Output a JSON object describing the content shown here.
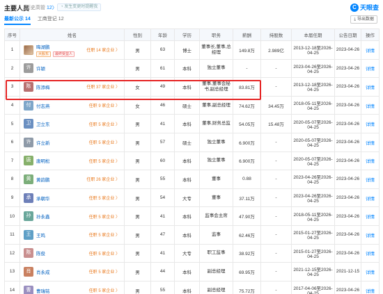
{
  "header": {
    "title": "主要人员",
    "history_label": "历史高管",
    "history_count": "12",
    "follow_label": "发生变更时提醒我",
    "logo_text": "天眼查"
  },
  "tabs": [
    {
      "label": "最新公示",
      "count": "14"
    },
    {
      "label": "工商登记",
      "count": "12"
    }
  ],
  "export_label": "导出数据",
  "columns": [
    "序号",
    "姓名",
    "性别",
    "年龄",
    "学历",
    "职务",
    "薪酬",
    "持股数",
    "本届任期",
    "公告日期",
    "操作"
  ],
  "rows": [
    {
      "no": "1",
      "avatar": "",
      "avatar_color": "#a07050",
      "name": "晦湖鹏",
      "tags": [
        "大股东",
        "最终受益人"
      ],
      "posts": "任职 14 家企业 〉",
      "gender": "男",
      "age": "63",
      "edu": "博士",
      "position": "董事长,董事,总经理",
      "salary": "149.8万",
      "shares": "2.989亿",
      "term": "2013-12-18至2026-04-25",
      "date": "2023-04-26",
      "action": "详情"
    },
    {
      "no": "2",
      "avatar": "许",
      "avatar_color": "#9c9c9c",
      "name": "许颖",
      "tags": [],
      "posts": "",
      "gender": "男",
      "age": "61",
      "edu": "本科",
      "position": "独立董事",
      "salary": "-",
      "shares": "-",
      "term": "2023-04-26至2026-04-25",
      "date": "2023-04-26",
      "action": "详情"
    },
    {
      "no": "3",
      "avatar": "陈",
      "avatar_color": "#b87070",
      "name": "陈添梅",
      "tags": [],
      "posts": "任职 37 家企业 〉",
      "gender": "女",
      "age": "49",
      "edu": "本科",
      "position": "董事,董事会秘书,副总经理",
      "salary": "83.81万",
      "shares": "-",
      "term": "2013-12-18至2026-04-25",
      "date": "2023-04-26",
      "action": "详情"
    },
    {
      "no": "4",
      "avatar": "付",
      "avatar_color": "#7ea6c9",
      "name": "付志燕",
      "tags": [],
      "posts": "任职 9 家企业 〉",
      "gender": "女",
      "age": "46",
      "edu": "硕士",
      "position": "董事,副总经理",
      "salary": "74.62万",
      "shares": "34.45万",
      "term": "2018-05-11至2026-04-25",
      "date": "2023-04-26",
      "action": "详情"
    },
    {
      "no": "5",
      "avatar": "卫",
      "avatar_color": "#6a8fc1",
      "name": "卫立东",
      "tags": [],
      "posts": "任职 5 家企业 〉",
      "gender": "男",
      "age": "41",
      "edu": "本科",
      "position": "董事,财务总监",
      "salary": "54.05万",
      "shares": "15.48万",
      "term": "2020-05-07至2026-04-25",
      "date": "2023-04-26",
      "action": "详情"
    },
    {
      "no": "6",
      "avatar": "许",
      "avatar_color": "#8e9aa8",
      "name": "许立新",
      "tags": [],
      "posts": "任职 5 家企业 〉",
      "gender": "男",
      "age": "57",
      "edu": "硕士",
      "position": "独立董事",
      "salary": "6.900万",
      "shares": "-",
      "term": "2020-05-07至2026-04-25",
      "date": "2023-04-26",
      "action": "详情"
    },
    {
      "no": "7",
      "avatar": "唐",
      "avatar_color": "#86b06a",
      "name": "唐明松",
      "tags": [],
      "posts": "任职 5 家企业 〉",
      "gender": "男",
      "age": "60",
      "edu": "本科",
      "position": "独立董事",
      "salary": "6.900万",
      "shares": "-",
      "term": "2020-05-07至2026-04-25",
      "date": "2023-04-26",
      "action": "详情"
    },
    {
      "no": "8",
      "avatar": "黄",
      "avatar_color": "#7cae7a",
      "name": "黄韵鹏",
      "tags": [],
      "posts": "任职 26 家企业 〉",
      "gender": "男",
      "age": "55",
      "edu": "本科",
      "position": "董事",
      "salary": "0.88",
      "shares": "-",
      "term": "2023-04-26至2026-04-25",
      "date": "2023-04-26",
      "action": "详情"
    },
    {
      "no": "9",
      "avatar": "承",
      "avatar_color": "#6d7fb8",
      "name": "承朝华",
      "tags": [],
      "posts": "任职 5 家企业 〉",
      "gender": "男",
      "age": "54",
      "edu": "大专",
      "position": "董事",
      "salary": "37.11万",
      "shares": "-",
      "term": "2023-04-26至2026-04-25",
      "date": "2023-04-26",
      "action": "详情"
    },
    {
      "no": "10",
      "avatar": "孙",
      "avatar_color": "#68a69a",
      "name": "孙永鑫",
      "tags": [],
      "posts": "任职 5 家企业 〉",
      "gender": "男",
      "age": "41",
      "edu": "本科",
      "position": "监事会主席",
      "salary": "47.90万",
      "shares": "-",
      "term": "2018-05-11至2026-04-25",
      "date": "2023-04-26",
      "action": "详情"
    },
    {
      "no": "11",
      "avatar": "王",
      "avatar_color": "#5e9fc6",
      "name": "王鸣",
      "tags": [],
      "posts": "任职 5 家企业 〉",
      "gender": "男",
      "age": "47",
      "edu": "本科",
      "position": "监事",
      "salary": "62.46万",
      "shares": "-",
      "term": "2015-01-27至2026-04-25",
      "date": "2023-04-26",
      "action": "详情"
    },
    {
      "no": "12",
      "avatar": "陈",
      "avatar_color": "#c98f8f",
      "name": "陈俊",
      "tags": [],
      "posts": "任职 5 家企业 〉",
      "gender": "男",
      "age": "41",
      "edu": "大专",
      "position": "职工监事",
      "salary": "38.92万",
      "shares": "-",
      "term": "2015-01-27至2026-04-25",
      "date": "2023-04-26",
      "action": "详情"
    },
    {
      "no": "13",
      "avatar": "肖",
      "avatar_color": "#c98060",
      "name": "肖永成",
      "tags": [],
      "posts": "任职 5 家企业 〉",
      "gender": "男",
      "age": "44",
      "edu": "本科",
      "position": "副总经理",
      "salary": "69.95万",
      "shares": "-",
      "term": "2021-12-15至2026-04-25",
      "date": "2021-12-15",
      "action": "详情"
    },
    {
      "no": "14",
      "avatar": "曹",
      "avatar_color": "#9a8fc0",
      "name": "曹瑞铭",
      "tags": [],
      "posts": "任职 5 家企业 〉",
      "gender": "男",
      "age": "55",
      "edu": "本科",
      "position": "副总经理",
      "salary": "75.72万",
      "shares": "-",
      "term": "2017-04-06至2026-04-25",
      "date": "2023-04-26",
      "action": "详情"
    }
  ],
  "colors": {
    "accent": "#0084ff",
    "highlight": "#e52222",
    "posts": "#e97a1f"
  }
}
